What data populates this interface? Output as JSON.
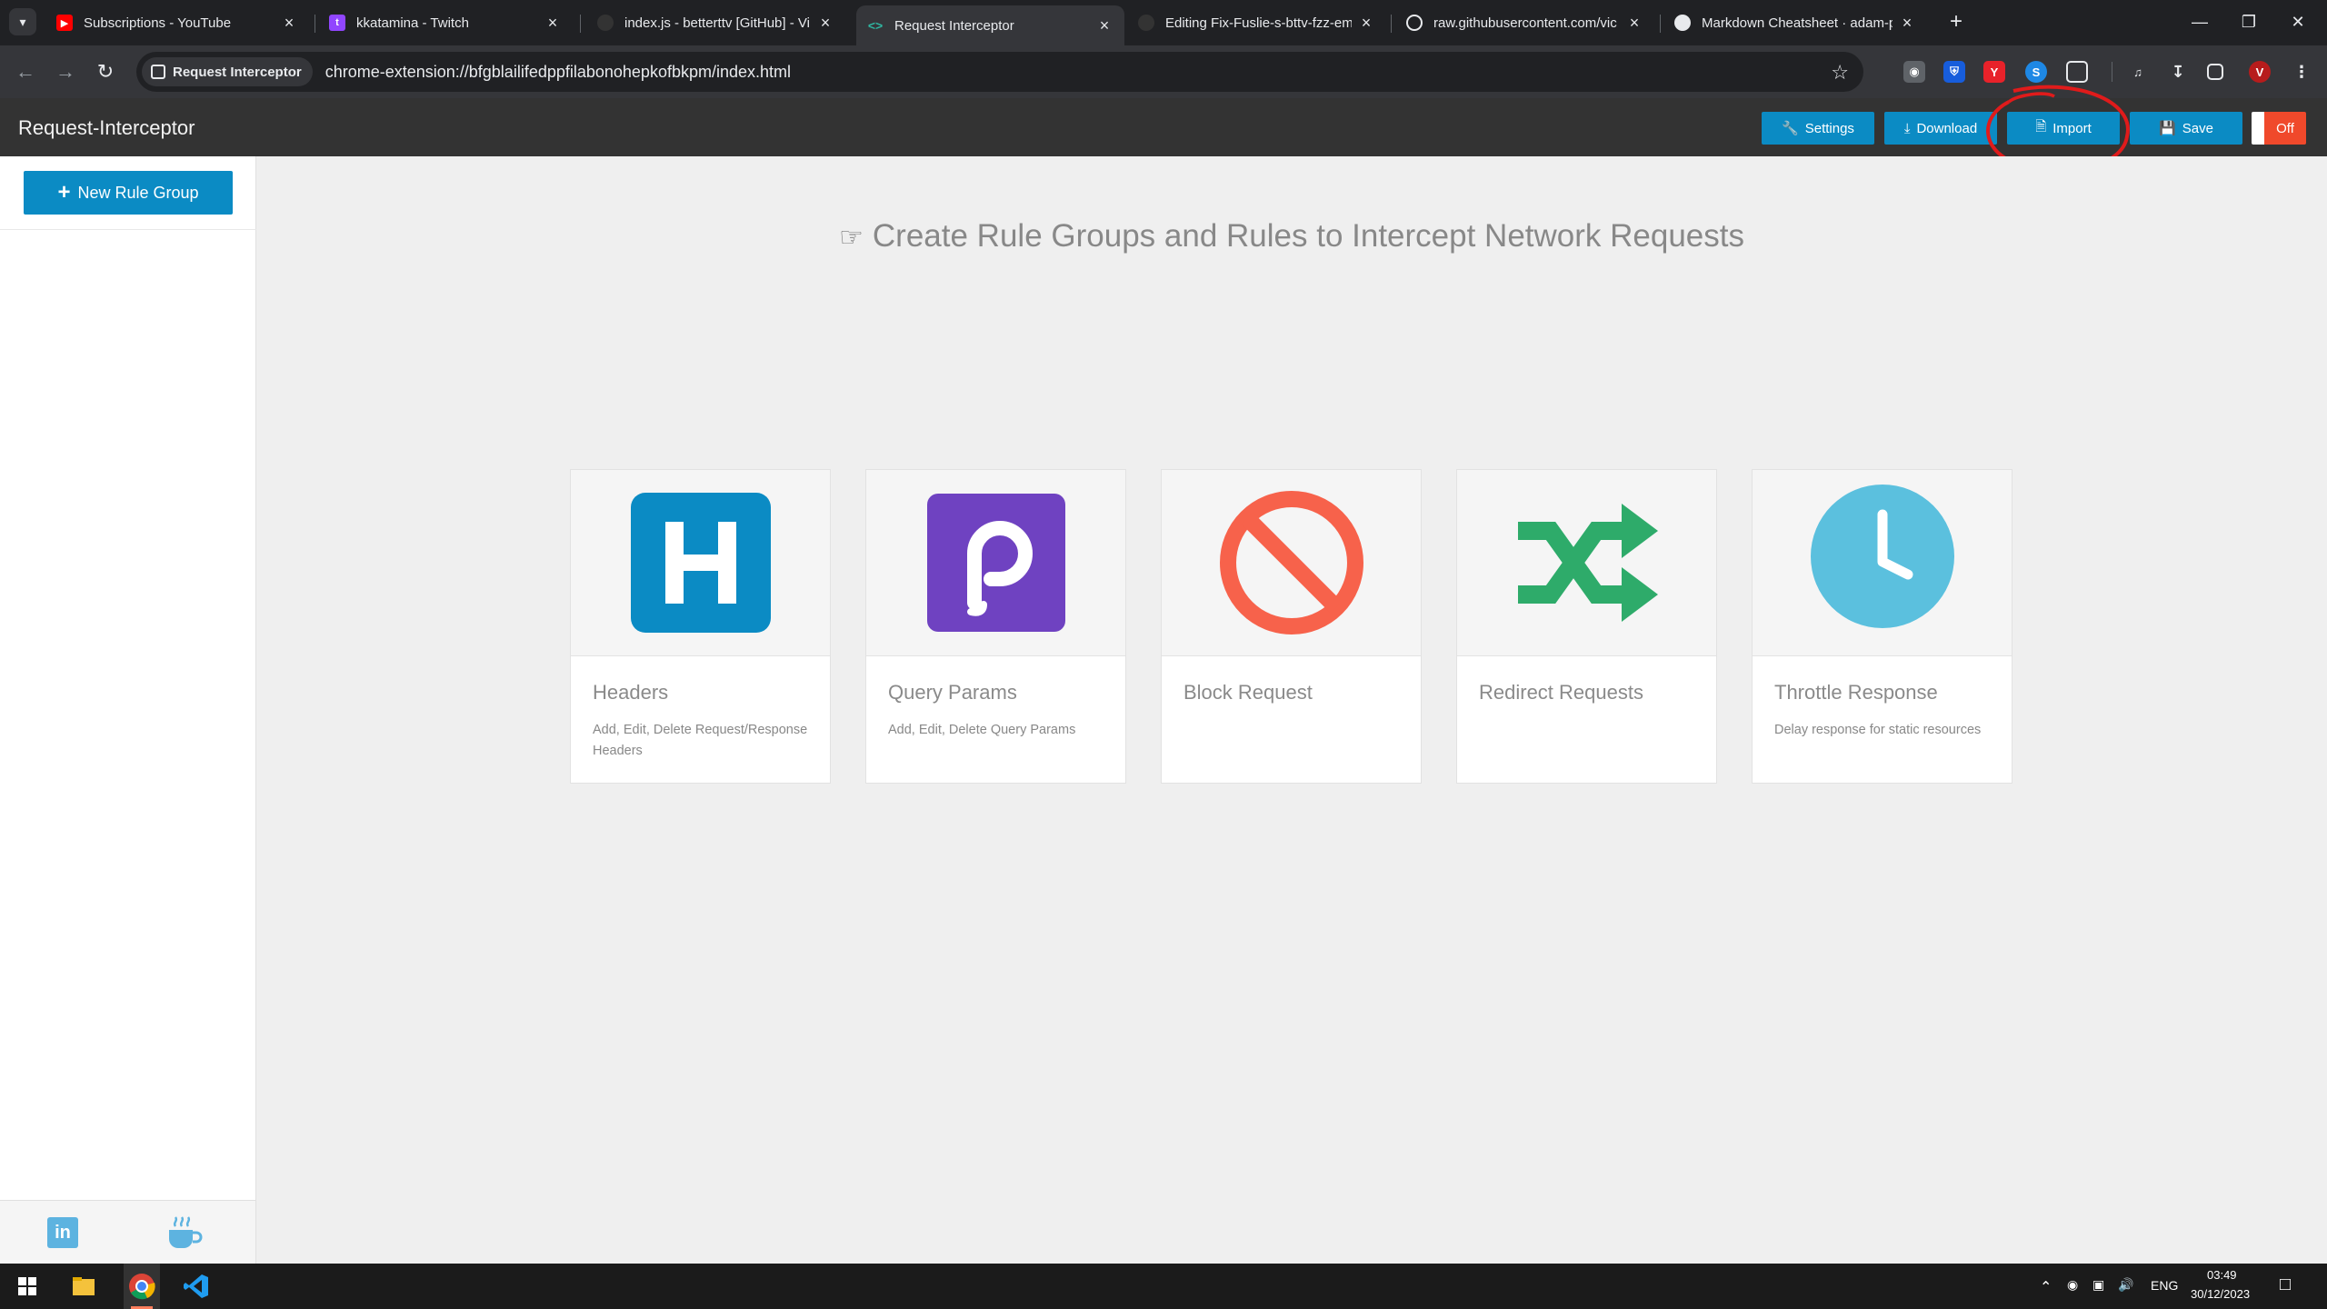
{
  "browser": {
    "tabs": [
      {
        "label": "Subscriptions - YouTube",
        "favicon": "youtube-icon"
      },
      {
        "label": "kkatamina - Twitch",
        "favicon": "twitch-icon"
      },
      {
        "label": "index.js - betterttv [GitHub] - Vi",
        "favicon": "github-icon"
      },
      {
        "label": "Request Interceptor",
        "favicon": "extension-icon",
        "active": true
      },
      {
        "label": "Editing Fix-Fuslie-s-bttv-fzz-em",
        "favicon": "github-icon"
      },
      {
        "label": "raw.githubusercontent.com/vic",
        "favicon": "globe-icon"
      },
      {
        "label": "Markdown Cheatsheet · adam-p",
        "favicon": "github-icon"
      }
    ],
    "address": {
      "chip_label": "Request Interceptor",
      "url": "chrome-extension://bfgblailifedppfilabonohepkofbkpm/index.html"
    }
  },
  "app": {
    "title": "Request-Interceptor",
    "header_buttons": {
      "settings": "Settings",
      "download": "Download",
      "import": "Import",
      "save": "Save"
    },
    "toggle_state": "Off",
    "new_rule_group": "New Rule Group",
    "headline": "Create Rule Groups and Rules to Intercept Network Requests",
    "cards": [
      {
        "title": "Headers",
        "description": "Add, Edit, Delete Request/Response Headers",
        "icon": "headers-h-icon",
        "color": "#0b8bc4"
      },
      {
        "title": "Query Params",
        "description": "Add, Edit, Delete Query Params",
        "icon": "query-params-p-icon",
        "color": "#6f42c1"
      },
      {
        "title": "Block Request",
        "description": "",
        "icon": "block-icon",
        "color": "#f7624b"
      },
      {
        "title": "Redirect Requests",
        "description": "",
        "icon": "shuffle-icon",
        "color": "#2eab6a"
      },
      {
        "title": "Throttle Response",
        "description": "Delay response for static resources",
        "icon": "clock-icon",
        "color": "#5bc0de"
      }
    ]
  },
  "taskbar": {
    "language": "ENG",
    "time": "03:49",
    "date": "30/12/2023"
  }
}
